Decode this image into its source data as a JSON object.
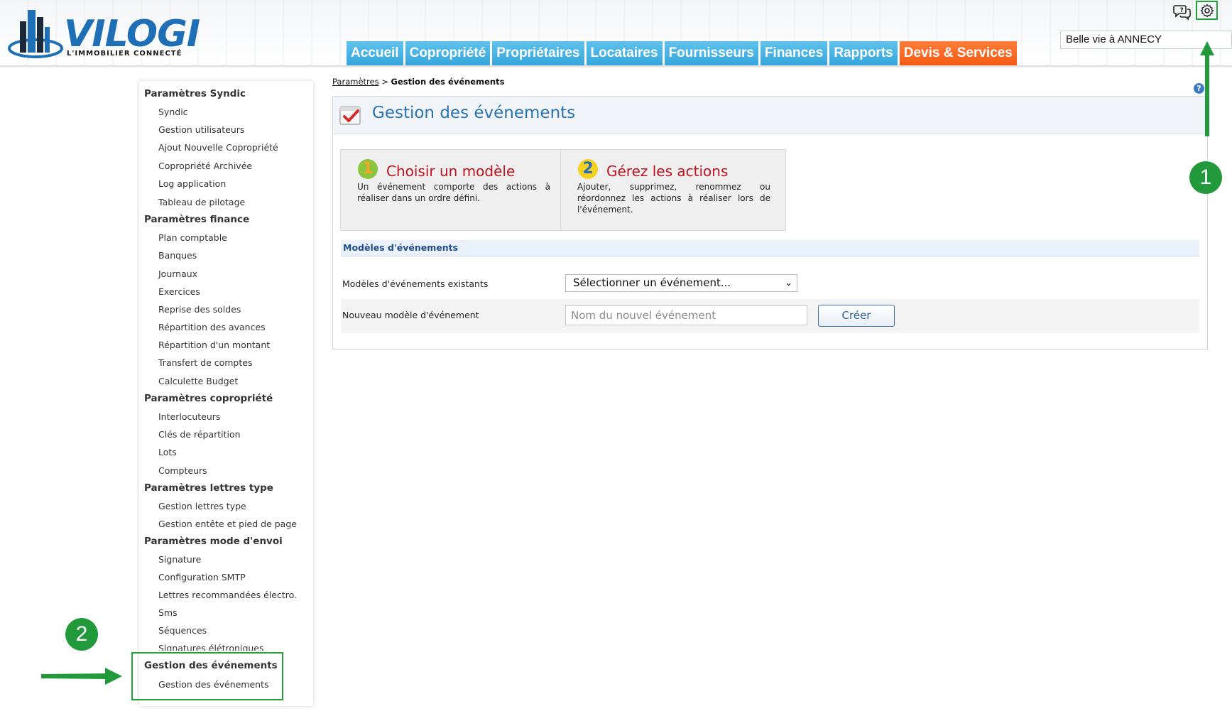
{
  "header": {
    "logo_text": "VILOGI",
    "logo_subtitle": "L'IMMOBILIER CONNECTÉ",
    "property_name": "Belle vie à ANNECY",
    "nav": [
      "Accueil",
      "Copropriété",
      "Propriétaires",
      "Locataires",
      "Fournisseurs",
      "Finances",
      "Rapports",
      "Devis & Services"
    ],
    "icons": [
      "chat-help-icon",
      "gear-icon"
    ]
  },
  "sidebar": {
    "sections": [
      {
        "title": "Paramètres Syndic",
        "items": [
          "Syndic",
          "Gestion utilisateurs",
          "Ajout Nouvelle Copropriété",
          "Copropriété Archivée",
          "Log application",
          "Tableau de pilotage"
        ]
      },
      {
        "title": "Paramètres finance",
        "items": [
          "Plan comptable",
          "Banques",
          "Journaux",
          "Exercices",
          "Reprise des soldes",
          "Répartition des avances",
          "Répartition d'un montant",
          "Transfert de comptes",
          "Calculette Budget"
        ]
      },
      {
        "title": "Paramètres copropriété",
        "items": [
          "Interlocuteurs",
          "Clés de répartition",
          "Lots",
          "Compteurs"
        ]
      },
      {
        "title": "Paramètres lettres type",
        "items": [
          "Gestion lettres type",
          "Gestion entête et pied de page"
        ]
      },
      {
        "title": "Paramètres mode d'envoi",
        "items": [
          "Signature",
          "Configuration SMTP",
          "Lettres recommandées électro.",
          "Sms",
          "Séquences",
          "Signatures élétroniques"
        ]
      },
      {
        "title": "Gestion des événements",
        "items": [
          "Gestion des événements"
        ]
      }
    ]
  },
  "breadcrumb": {
    "parent": "Paramètres",
    "separator": ">",
    "current": "Gestion des événements"
  },
  "main": {
    "title": "Gestion des événements",
    "steps": [
      {
        "num": "1",
        "title": "Choisir un modèle",
        "desc": "Un événement comporte des actions à réaliser dans un ordre défini."
      },
      {
        "num": "2",
        "title": "Gérez les actions",
        "desc": "Ajouter, supprimez, renommez ou réordonnez les actions à réaliser lors de l'événement."
      }
    ],
    "section_title": "Modèles d'événements",
    "existing_label": "Modèles d'événements existants",
    "select_value": "Sélectionner un événement...",
    "new_label": "Nouveau modèle d'événement",
    "new_placeholder": "Nom du nouvel événement",
    "create_button": "Créer"
  },
  "annotations": {
    "badge1": "1",
    "badge2": "2",
    "color": "#229a3c"
  }
}
